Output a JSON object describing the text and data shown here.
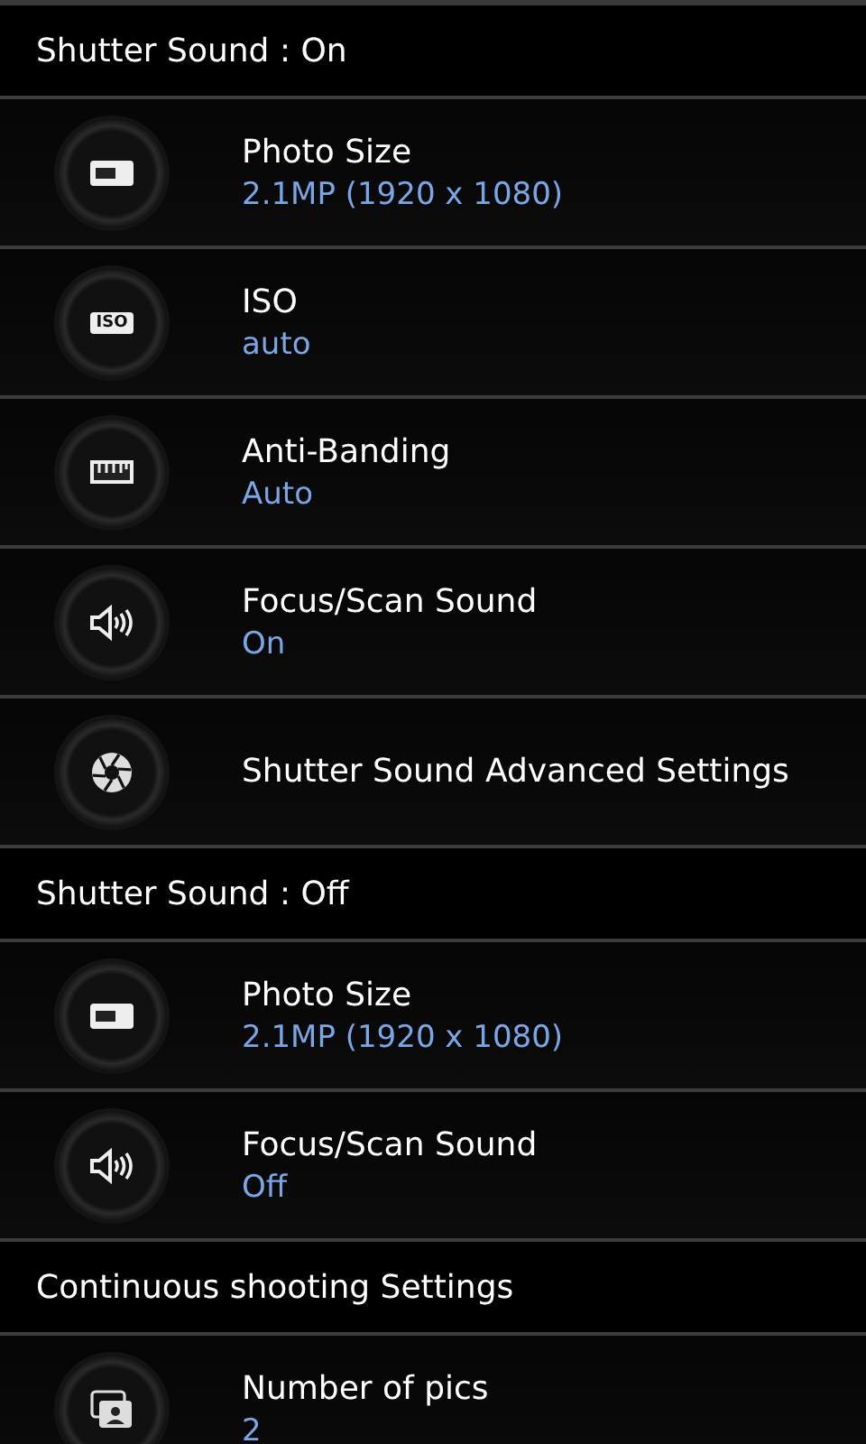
{
  "sections": [
    {
      "header": "Shutter Sound : On",
      "items": [
        {
          "kind": "size",
          "title": "Photo Size",
          "value": "2.1MP (1920 x 1080)"
        },
        {
          "kind": "iso",
          "icon_text": "ISO",
          "title": "ISO",
          "value": "auto"
        },
        {
          "kind": "banding",
          "title": "Anti-Banding",
          "value": "Auto"
        },
        {
          "kind": "sound",
          "title": "Focus/Scan Sound",
          "value": "On"
        },
        {
          "kind": "shutter",
          "title": "Shutter Sound Advanced Settings"
        }
      ]
    },
    {
      "header": "Shutter Sound : Off",
      "items": [
        {
          "kind": "size",
          "title": "Photo Size",
          "value": "2.1MP (1920 x 1080)"
        },
        {
          "kind": "sound",
          "title": "Focus/Scan Sound",
          "value": "Off"
        }
      ]
    },
    {
      "header": "Continuous shooting Settings",
      "items": [
        {
          "kind": "pics",
          "title": "Number of pics",
          "value": "2"
        }
      ]
    }
  ]
}
